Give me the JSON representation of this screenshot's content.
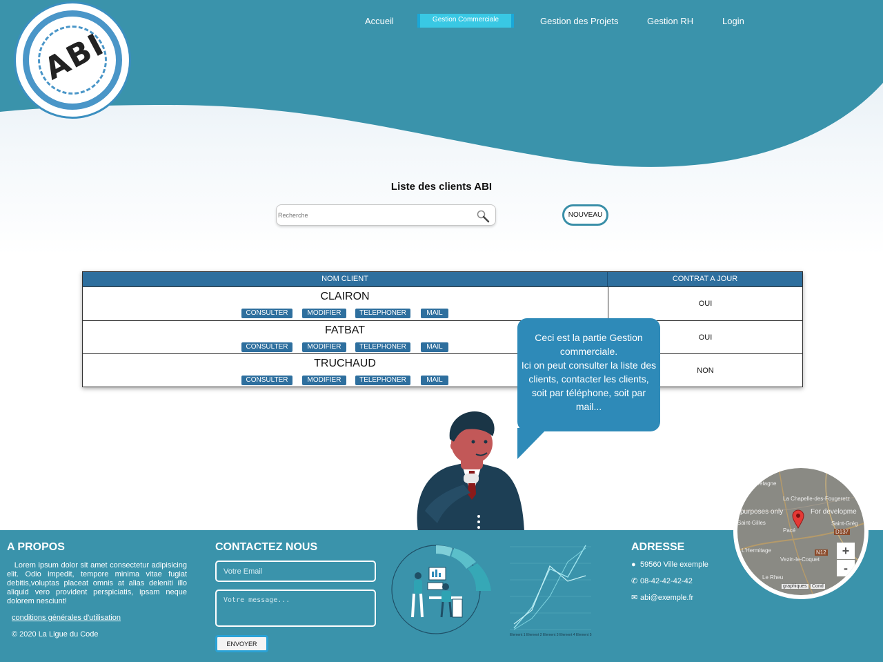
{
  "nav": {
    "items": [
      "Accueil",
      "Gestion Commerciale",
      "Gestion des Projets",
      "Gestion RH",
      "Login"
    ],
    "active": "Gestion Commerciale"
  },
  "logo": {
    "mark": "ABI"
  },
  "clients": {
    "title": "Liste des clients ABI",
    "search_placeholder": "Recherche",
    "new_label": "NOUVEAU",
    "columns": [
      "NOM CLIENT",
      "CONTRAT A JOUR"
    ],
    "actions": [
      "CONSULTER",
      "MODIFIER",
      "TELEPHONER",
      "MAIL"
    ],
    "rows": [
      {
        "name": "CLAIRON",
        "contract": "OUI"
      },
      {
        "name": "FATBAT",
        "contract": "OUI"
      },
      {
        "name": "TRUCHAUD",
        "contract": "NON"
      }
    ]
  },
  "bubble": {
    "lines": [
      "Ceci est la partie Gestion",
      "commerciale.",
      "Ici on peut consulter la liste des",
      "clients,  contacter les clients,",
      "soit par téléphone, soit par",
      "mail..."
    ]
  },
  "footer": {
    "about_title": "A PROPOS",
    "about_text": "Lorem ipsum dolor sit amet consectetur adipisicing elit. Odio impedit, tempore minima vitae fugiat debitis,voluptas placeat omnis at alias deleniti illo aliquid vero provident perspiciatis, ipsam neque dolorem nesciunt!",
    "cgu": "conditions générales d'utilisation",
    "copyright": "© 2020 La Ligue du Code",
    "contact_title": "CONTACTEZ NOUS",
    "email_placeholder": "Votre Email",
    "message_placeholder": "Votre message...",
    "send_label": "ENVOYER",
    "address_title": "ADRESSE",
    "address": "59560 Ville exemple",
    "phone": "08-42-42-42-42",
    "email": "abi@exemple.fr"
  },
  "map": {
    "labels": [
      "Bretagne",
      "La Chapelle-des-Fougeretz",
      "purposes only",
      "For developme",
      "Saint-Gilles",
      "Pacé",
      "Saint-Grég",
      "D137",
      "L'Hermitage",
      "Vezin-le-Coquet",
      "N12",
      "Le Rheu",
      "graphiques",
      "Cond"
    ],
    "zoom_in": "+",
    "zoom_out": "-"
  },
  "mini_chart": {
    "categories": [
      "Element 1",
      "Element 2",
      "Element 3",
      "Element 4",
      "Element 5"
    ]
  },
  "colors": {
    "accent": "#3a93ab",
    "table_header": "#2e6f9e",
    "bubble": "#2e8ab8"
  }
}
